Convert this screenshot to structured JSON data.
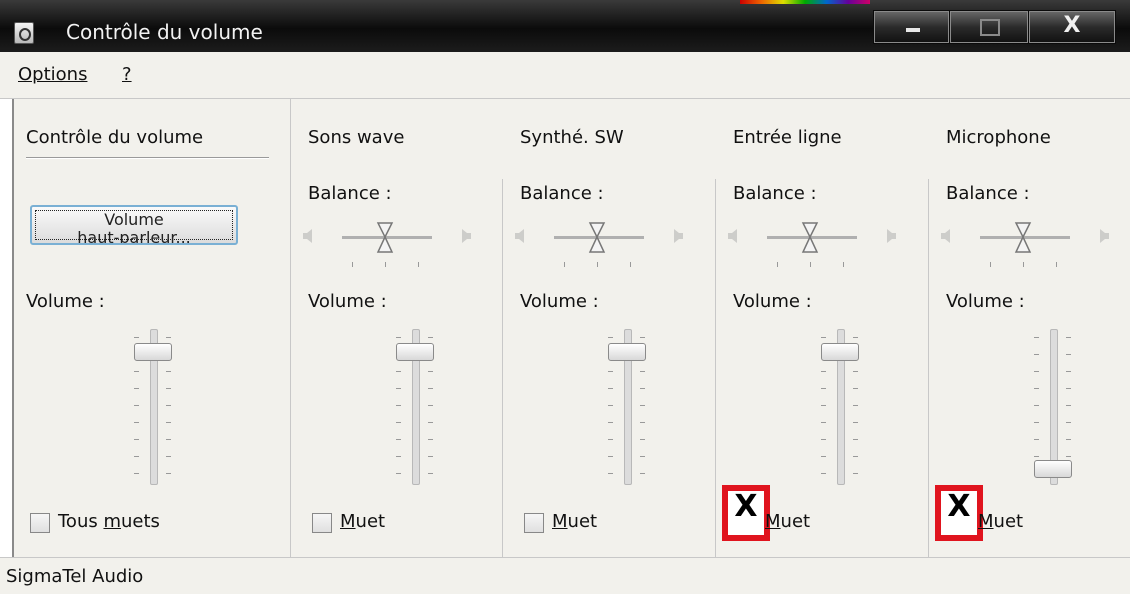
{
  "window": {
    "title": "Contrôle du volume",
    "close_glyph": "X"
  },
  "menu": {
    "options": "Options",
    "help": "?"
  },
  "master": {
    "title": "Contrôle du volume",
    "speaker_button_line1": "Volume",
    "speaker_button_line2": "haut-parleur...",
    "volume_label": "Volume :",
    "mute_label_prefix": "Tous ",
    "mute_label_ul": "m",
    "mute_label_rest": "uets",
    "muted": false,
    "volume_level": 0.9
  },
  "channels": [
    {
      "title": "Sons wave",
      "balance_label": "Balance :",
      "volume_label": "Volume :",
      "mute_ul": "M",
      "mute_rest": "uet",
      "muted": false,
      "volume_level": 0.9
    },
    {
      "title": "Synthé. SW",
      "balance_label": "Balance :",
      "volume_label": "Volume :",
      "mute_ul": "M",
      "mute_rest": "uet",
      "muted": false,
      "volume_level": 0.9
    },
    {
      "title": "Entrée ligne",
      "balance_label": "Balance :",
      "volume_label": "Volume :",
      "mute_ul": "M",
      "mute_rest": "uet",
      "muted": true,
      "volume_level": 0.9
    },
    {
      "title": "Microphone",
      "balance_label": "Balance :",
      "volume_label": "Volume :",
      "mute_ul": "M",
      "mute_rest": "uet",
      "muted": true,
      "volume_level": 0.05
    }
  ],
  "icons": {
    "app": "speaker-icon",
    "balance_left": "speaker-left-icon",
    "balance_right": "speaker-right-icon",
    "mute_check": "X"
  },
  "colors": {
    "highlight": "#e0141e",
    "titlebar": "#1a1a1a",
    "background": "#f2f1ec"
  },
  "status": {
    "device": "SigmaTel Audio"
  }
}
